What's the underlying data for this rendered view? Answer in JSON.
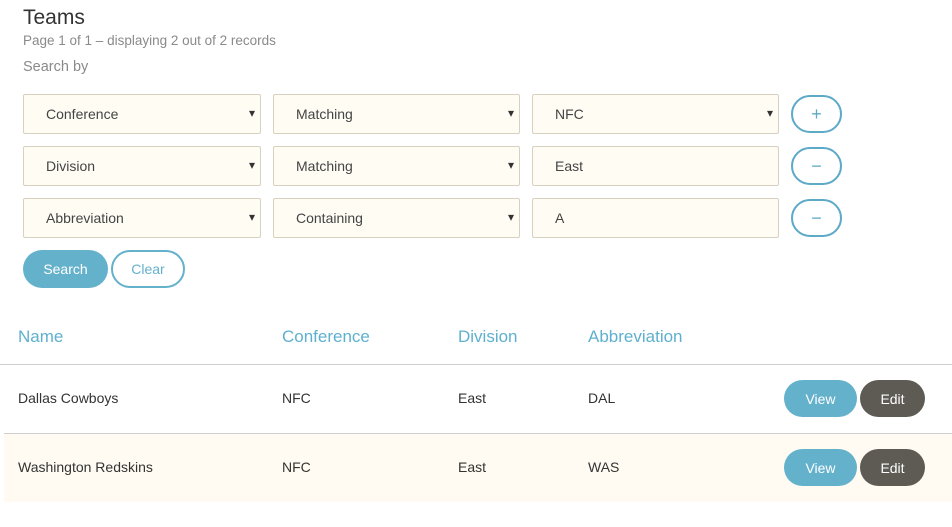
{
  "page": {
    "title": "Teams",
    "subtitle": "Page 1 of 1 – displaying 2 out of 2 records",
    "search_by_label": "Search by"
  },
  "filters": [
    {
      "field": "Conference",
      "operator": "Matching",
      "value": "NFC",
      "value_is_select": true,
      "action": "+"
    },
    {
      "field": "Division",
      "operator": "Matching",
      "value": "East",
      "value_is_select": false,
      "action": "−"
    },
    {
      "field": "Abbreviation",
      "operator": "Containing",
      "value": "A",
      "value_is_select": false,
      "action": "−"
    }
  ],
  "buttons": {
    "search": "Search",
    "clear": "Clear"
  },
  "table": {
    "columns": [
      "Name",
      "Conference",
      "Division",
      "Abbreviation"
    ],
    "rows": [
      {
        "name": "Dallas Cowboys",
        "conference": "NFC",
        "division": "East",
        "abbreviation": "DAL"
      },
      {
        "name": "Washington Redskins",
        "conference": "NFC",
        "division": "East",
        "abbreviation": "WAS"
      }
    ],
    "row_actions": {
      "view": "View",
      "edit": "Edit"
    }
  },
  "colors": {
    "accent": "#64b1cc",
    "edit": "#5e5b55",
    "field_bg": "#fffcf4"
  }
}
